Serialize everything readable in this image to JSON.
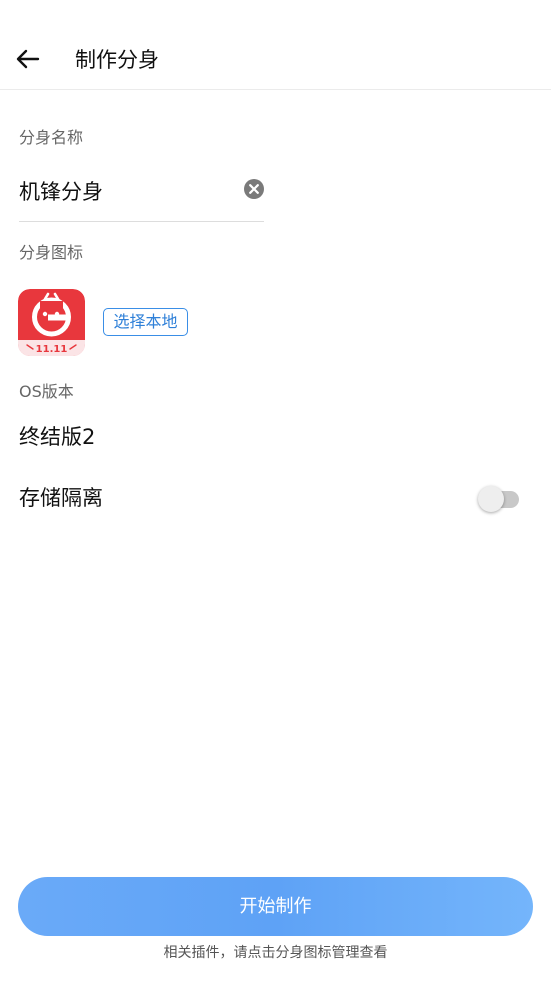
{
  "header": {
    "title": "制作分身"
  },
  "name_section": {
    "label": "分身名称",
    "value": "机锋分身"
  },
  "icon_section": {
    "label": "分身图标",
    "app_icon": {
      "icon": "app-logo-icon",
      "badge_text": "11.11",
      "brand_color": "#e8373d"
    },
    "choose_local_label": "选择本地"
  },
  "os_section": {
    "label": "OS版本",
    "value": "终结版2"
  },
  "storage_isolation": {
    "label": "存储隔离",
    "enabled": false
  },
  "footer": {
    "start_button_label": "开始制作",
    "hint": "相关插件，请点击分身图标管理查看"
  },
  "colors": {
    "accent": "#5ea2f6",
    "link_blue": "#2f80d8",
    "text_primary": "#111111",
    "text_secondary": "#666666"
  }
}
